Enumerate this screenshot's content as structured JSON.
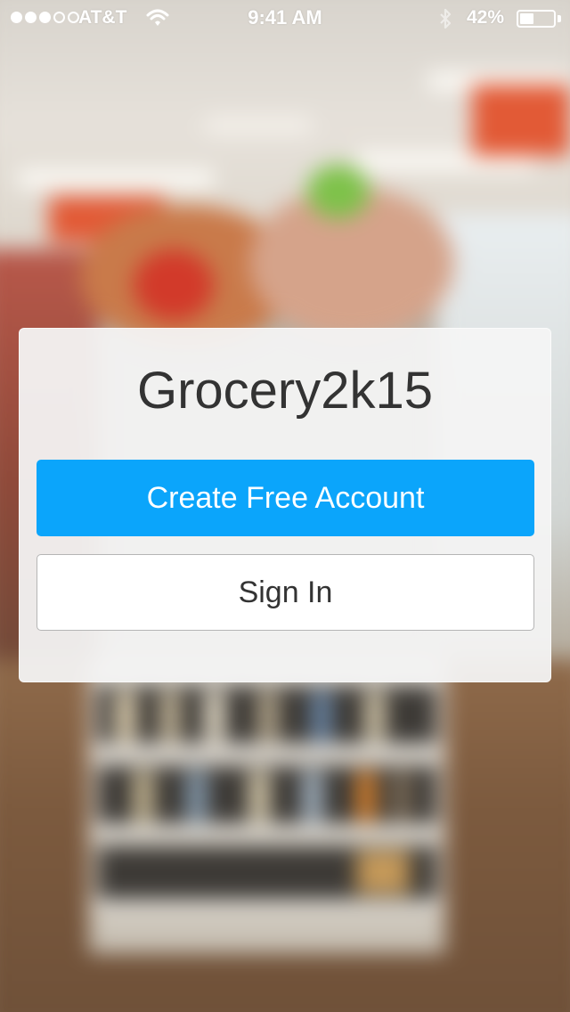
{
  "status_bar": {
    "carrier": "AT&T",
    "signal_strength": 3,
    "signal_max": 5,
    "time": "9:41 AM",
    "battery_percent": "42%",
    "battery_level": 0.42,
    "icons": [
      "wifi-icon",
      "bluetooth-icon",
      "battery-icon"
    ]
  },
  "card": {
    "app_name": "Grocery2k15",
    "primary_button": "Create Free Account",
    "secondary_button": "Sign In"
  },
  "colors": {
    "primary_button": "#0ba5fb",
    "primary_text": "#ffffff",
    "secondary_button": "#ffffff",
    "secondary_text": "#333333",
    "title_text": "#333333"
  }
}
